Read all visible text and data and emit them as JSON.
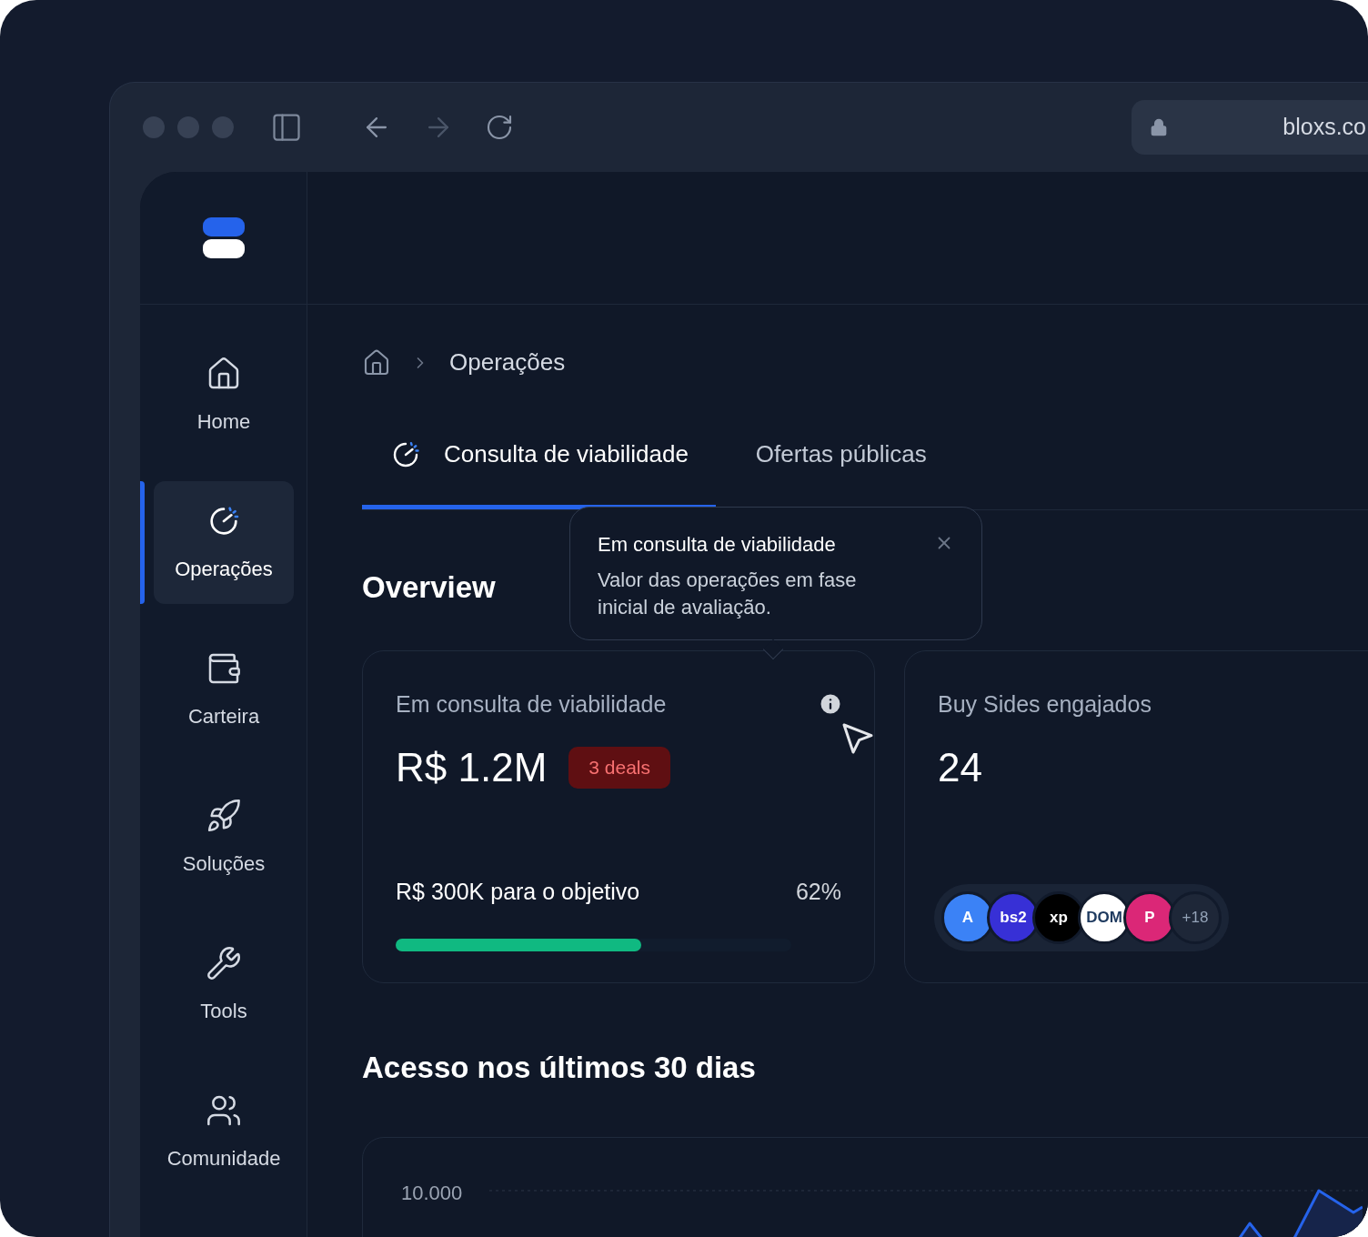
{
  "browser": {
    "address": "bloxs.co"
  },
  "sidebar": {
    "items": [
      {
        "label": "Home",
        "selected": false
      },
      {
        "label": "Operações",
        "selected": true
      },
      {
        "label": "Carteira",
        "selected": false
      },
      {
        "label": "Soluções",
        "selected": false
      },
      {
        "label": "Tools",
        "selected": false
      },
      {
        "label": "Comunidade",
        "selected": false
      }
    ]
  },
  "breadcrumb": [
    "Operações"
  ],
  "tabs": [
    {
      "label": "Consulta de viabilidade",
      "selected": true
    },
    {
      "label": "Ofertas públicas",
      "selected": false
    }
  ],
  "overview": {
    "title": "Overview",
    "tooltip": {
      "title": "Em consulta de viabilidade",
      "text": "Valor das operações em fase inicial de avaliação."
    },
    "cards": [
      {
        "kind": "progress",
        "title": "Em consulta de viabilidade",
        "value": "R$ 1.2M",
        "badge": "3 deals",
        "goal": "R$ 300K para o objetivo",
        "percent": "62%",
        "level": 0.62
      },
      {
        "kind": "avatars",
        "title": "Buy Sides engajados",
        "value": "24",
        "avatars": [
          {
            "label": "A",
            "color": "#3b82f6"
          },
          {
            "label": "bs2",
            "color": "#3730d6"
          },
          {
            "label": "xp",
            "color": "#000000"
          },
          {
            "label": "DOM",
            "color": "#ffffff"
          },
          {
            "label": "P",
            "color": "#db2777"
          },
          {
            "label": "+18",
            "color": "#1e2738"
          }
        ]
      }
    ]
  },
  "access": {
    "title": "Acesso nos últimos 30 dias",
    "y_tick": "10.000"
  }
}
